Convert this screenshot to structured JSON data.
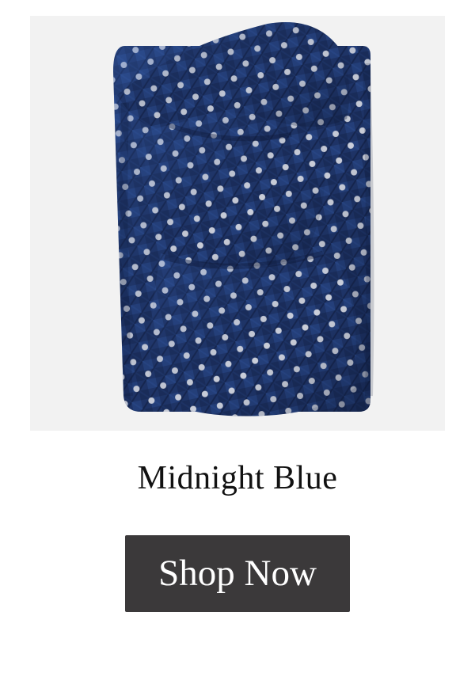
{
  "product": {
    "name": "Midnight Blue",
    "image_alt": "Folded navy tie with white dots",
    "colors": {
      "tie_base": "#1f3569",
      "tie_dark": "#16264f",
      "tie_light": "#34559a",
      "dot": "#e6e8ee",
      "image_bg": "#f2f2f2"
    }
  },
  "cta": {
    "shop_label": "Shop Now",
    "button_color": "#3b393a"
  }
}
